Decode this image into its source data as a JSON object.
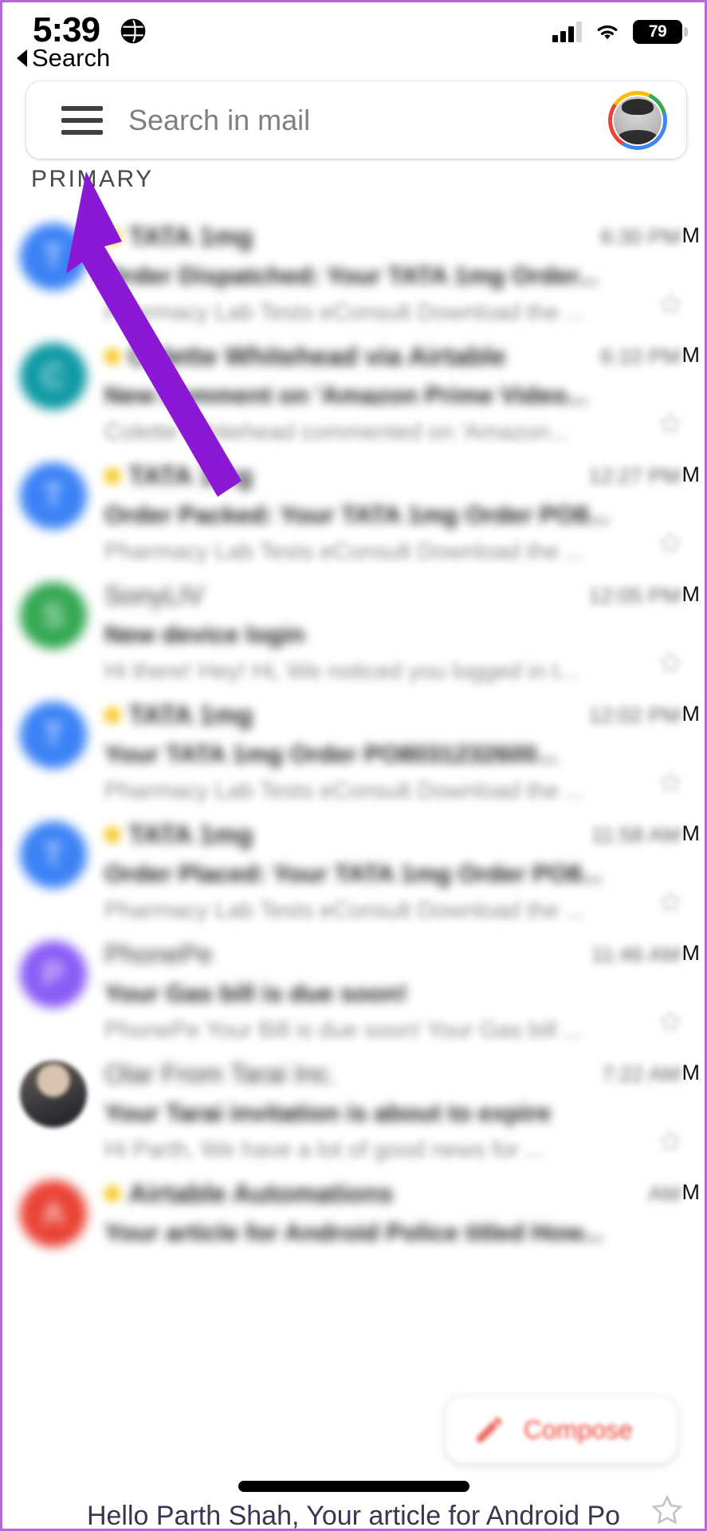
{
  "status_bar": {
    "time": "5:39",
    "location_icon": "globe-icon",
    "signal_icon": "cellular-signal-icon",
    "wifi_icon": "wifi-icon",
    "battery_level": "79"
  },
  "back_nav": {
    "label": "Search",
    "icon": "back-caret-icon"
  },
  "search": {
    "menu_icon": "hamburger-menu-icon",
    "placeholder": "Search in mail",
    "avatar_icon": "account-avatar"
  },
  "tabs": {
    "active": "PRIMARY"
  },
  "compose": {
    "label": "Compose",
    "icon": "pencil-icon",
    "accent": "#ea4335"
  },
  "annotation": {
    "type": "arrow",
    "color": "#8b18d4",
    "points_to": "hamburger-menu-icon"
  },
  "bottom": {
    "preview_text": "Hello Parth Shah, Your article for Android Po",
    "star_icon": "star-outline-icon",
    "home_indicator": "home-indicator"
  },
  "emails": [
    {
      "sender": "TATA 1mg",
      "subject": "Order Dispatched: Your TATA 1mg Order...",
      "snippet": "Pharmacy Lab Tests eConsult Download the ...",
      "time": "6:30 PM",
      "avatar_color": "#3b82f6",
      "avatar_letter": "T",
      "important": true
    },
    {
      "sender": "Colette Whitehead via Airtable",
      "subject": "New comment on 'Amazon Prime Video...",
      "snippet": "Colette Whitehead commented on 'Amazon...",
      "time": "6:10 PM",
      "avatar_color": "#0f9aa5",
      "avatar_letter": "C",
      "important": true
    },
    {
      "sender": "TATA 1mg",
      "subject": "Order Packed: Your TATA 1mg Order PO8...",
      "snippet": "Pharmacy Lab Tests eConsult Download the ...",
      "time": "12:27 PM",
      "avatar_color": "#3b82f6",
      "avatar_letter": "T",
      "important": true
    },
    {
      "sender": "SonyLIV",
      "subject": "New device login",
      "snippet": "Hi there! Hey! Hi, We noticed you logged in t...",
      "time": "12:05 PM",
      "avatar_color": "#34a853",
      "avatar_letter": "S",
      "important": false
    },
    {
      "sender": "TATA 1mg",
      "subject": "Your TATA 1mg Order PO8031232600...",
      "snippet": "Pharmacy Lab Tests eConsult Download the ...",
      "time": "12:02 PM",
      "avatar_color": "#3b82f6",
      "avatar_letter": "T",
      "important": true
    },
    {
      "sender": "TATA 1mg",
      "subject": "Order Placed: Your TATA 1mg Order PO8...",
      "snippet": "Pharmacy Lab Tests eConsult Download the ...",
      "time": "11:58 AM",
      "avatar_color": "#3b82f6",
      "avatar_letter": "T",
      "important": true
    },
    {
      "sender": "PhonePe",
      "subject": "Your Gas bill is due soon!",
      "snippet": "PhonePe Your Bill is due soon! Your Gas bill ...",
      "time": "11:46 AM",
      "avatar_color": "#8b5cf6",
      "avatar_letter": "P",
      "important": false
    },
    {
      "sender": "Olar From Tarai Inc.",
      "subject": "Your Tarai invitation is about to expire",
      "snippet": "Hi Parth, We have a lot of good news for ...",
      "time": "7:22 AM",
      "avatar_color": "photo",
      "avatar_letter": "",
      "important": false
    },
    {
      "sender": "Airtable Automations",
      "subject": "Your article for Android Police titled How...",
      "snippet": "",
      "time": "AM",
      "avatar_color": "#ea4335",
      "avatar_letter": "A",
      "important": true
    }
  ]
}
